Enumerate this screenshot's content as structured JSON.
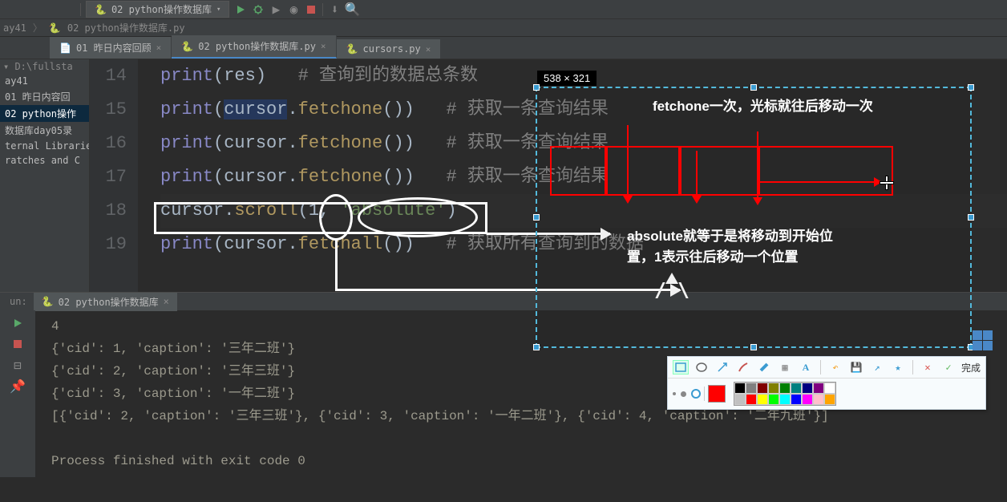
{
  "toolbar": {
    "run_config": "02 python操作数据库"
  },
  "breadcrumb": {
    "part1": "ay41",
    "part2": "02 python操作数据库.py"
  },
  "tabs": [
    {
      "label": "01 昨日内容回顾"
    },
    {
      "label": "02 python操作数据库.py"
    },
    {
      "label": "cursors.py"
    }
  ],
  "sidebar": {
    "root_drive": "D:\\fullsta",
    "items": [
      {
        "label": "ay41"
      },
      {
        "label": "01 昨日内容回"
      },
      {
        "label": "02 python操作"
      },
      {
        "label": "数据库day05录"
      },
      {
        "label": "ternal Libraries"
      },
      {
        "label": "ratches and C"
      }
    ]
  },
  "code": {
    "lines": [
      {
        "num": "14",
        "type": "print_call",
        "arg": "res",
        "comment": "# 查询到的数据总条数"
      },
      {
        "num": "15",
        "type": "print_method",
        "obj": "cursor",
        "method": "fetchone",
        "comment": "# 获取一条查询结果"
      },
      {
        "num": "16",
        "type": "print_method",
        "obj": "cursor",
        "method": "fetchone",
        "comment": "# 获取一条查询结果"
      },
      {
        "num": "17",
        "type": "print_method",
        "obj": "cursor",
        "method": "fetchone",
        "comment": "# 获取一条查询结果"
      },
      {
        "num": "18",
        "type": "scroll",
        "obj": "cursor",
        "method": "scroll",
        "arg_num": "1",
        "arg_str": "'absolute'"
      },
      {
        "num": "19",
        "type": "print_method",
        "obj": "cursor",
        "method": "fetchall",
        "comment": "# 获取所有查询到的数据"
      }
    ]
  },
  "annotation": {
    "dimensions": "538 × 321",
    "text1": "fetchone一次，光标就往后移动一次",
    "text2_l1": "absolute就等于是将移动到开始位",
    "text2_l2": "置，1表示往后移动一个位置"
  },
  "run": {
    "label": "un:",
    "tab": "02 python操作数据库",
    "output": [
      "4",
      "{'cid': 1, 'caption': '三年二班'}",
      "{'cid': 2, 'caption': '三年三班'}",
      "{'cid': 3, 'caption': '一年二班'}",
      "[{'cid': 2, 'caption': '三年三班'}, {'cid': 3, 'caption': '一年二班'}, {'cid': 4, 'caption': '二年九班'}]",
      "",
      "Process finished with exit code 0"
    ]
  },
  "snip": {
    "done": "完成",
    "current_color": "#ff0000",
    "palette_row1": [
      "#000000",
      "#808080",
      "#800000",
      "#808000",
      "#008000",
      "#008080",
      "#000080",
      "#800080",
      "#ffffff"
    ],
    "palette_row2": [
      "#c0c0c0",
      "#ff0000",
      "#ffff00",
      "#00ff00",
      "#00ffff",
      "#0000ff",
      "#ff00ff",
      "#ffc0cb",
      "#ffa500"
    ]
  }
}
